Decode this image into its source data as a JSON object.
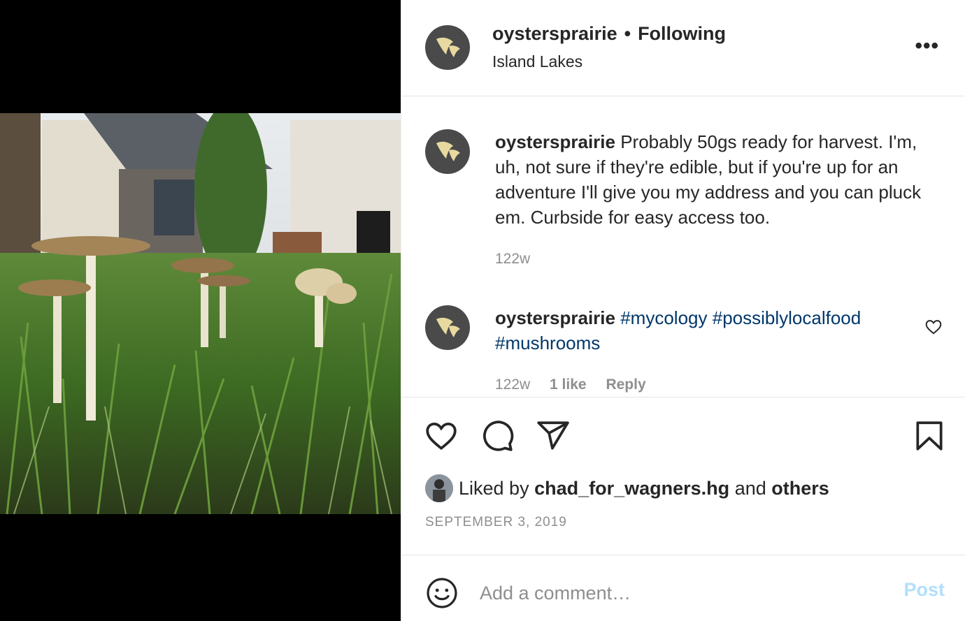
{
  "post": {
    "author": "oystersprairie",
    "follow_dot": "•",
    "follow_state": "Following",
    "location": "Island Lakes",
    "more_label": "•••"
  },
  "comments": [
    {
      "author": "oystersprairie",
      "text": "Probably 50gs ready for harvest. I'm, uh, not sure if they're edible, but if you're up for an adventure I'll give you my address and you can pluck em. Curbside for easy access too.",
      "time": "122w"
    },
    {
      "author": "oystersprairie",
      "tags": [
        "#mycology",
        "#possiblylocalfood",
        "#mushrooms"
      ],
      "time": "122w",
      "likes": "1 like",
      "reply": "Reply"
    }
  ],
  "likes": {
    "prefix": "Liked by",
    "user": "chad_for_wagners.hg",
    "and": "and",
    "others": "others"
  },
  "date": "SEPTEMBER 3, 2019",
  "composer": {
    "placeholder": "Add a comment…",
    "post_label": "Post"
  },
  "colors": {
    "hashtag": "#00376b",
    "post_disabled": "#b2dffc",
    "avatar_bg": "#4a4a4a",
    "logo": "#e8d9a0"
  },
  "icons": [
    "more-options-icon",
    "heart-icon",
    "comment-icon",
    "share-icon",
    "bookmark-icon",
    "smiley-icon",
    "oyster-logo-icon"
  ]
}
